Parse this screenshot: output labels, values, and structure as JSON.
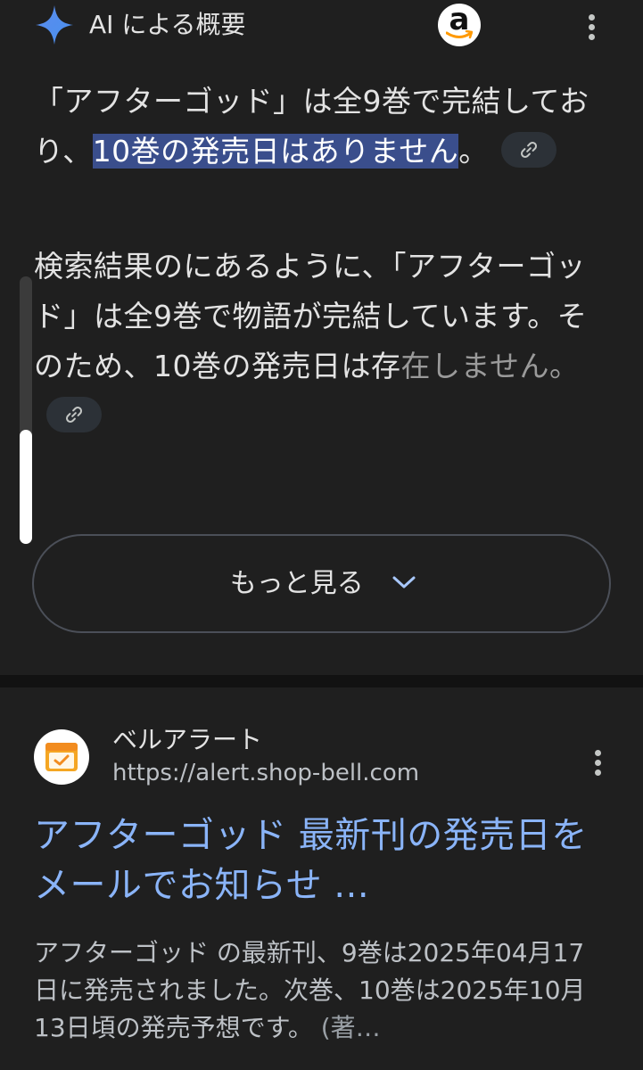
{
  "ai_overview": {
    "title": "AI による概要",
    "paragraph1": {
      "text_before": "「アフターゴッド」は全9巻で完結しており、",
      "highlight": "10巻の発売日はありません",
      "text_after": "。"
    },
    "paragraph2": {
      "text": "検索結果のにあるように、「アフターゴッド」は全9巻で物語が完結しています。そのため、10巻の発売日は存",
      "text_faded": "在しません。"
    },
    "more_button_label": "もっと見る",
    "scroll_progress": 0.43
  },
  "result": {
    "site_name": "ベルアラート",
    "site_url": "https://alert.shop-bell.com",
    "title": "アフターゴッド 最新刊の発売日をメールでお知らせ ...",
    "snippet": "アフターゴッド の最新刊、9巻は2025年04月17日に発売されました。次巻、10巻は2025年10月13日頃の発売予想です。",
    "snippet_faded": " (著…"
  },
  "colors": {
    "background": "#1f1f1f",
    "highlight": "#3a4e8c",
    "link_title": "#8ab4f8",
    "sparkle": "#4a90ee"
  },
  "icons": [
    "sparkle-icon",
    "amazon-logo-icon",
    "more-vert-icon",
    "link-icon",
    "chevron-down-icon",
    "calendar-favicon-icon"
  ]
}
